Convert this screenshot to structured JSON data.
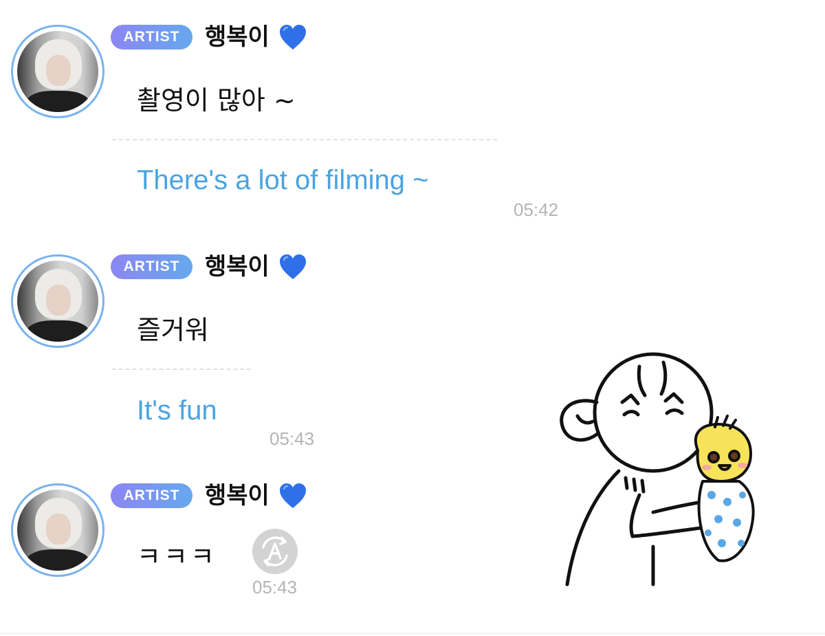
{
  "messages": [
    {
      "badge": "ARTIST",
      "sender": "행복이",
      "text": "촬영이 많아 ~",
      "translation": "There's a lot of filming ~",
      "time": "05:42"
    },
    {
      "badge": "ARTIST",
      "sender": "행복이",
      "text": "즐거워",
      "translation": "It's fun",
      "time": "05:43"
    },
    {
      "badge": "ARTIST",
      "sender": "행복이",
      "text": "ㅋㅋㅋ",
      "time": "05:43"
    }
  ],
  "icons": {
    "heart": "blue-heart-icon",
    "translate": "auto-translate-icon",
    "sticker": "kissing-baby-chick-sticker"
  },
  "colors": {
    "badge_start": "#8c86f2",
    "badge_end": "#66a8ee",
    "translation": "#4aa3e0",
    "heart": "#2f6fe8",
    "avatar_ring": "#7ab3ee",
    "time": "#b4b4b4"
  }
}
